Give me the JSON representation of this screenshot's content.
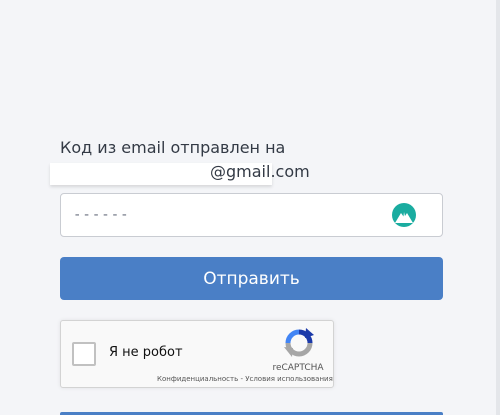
{
  "message": {
    "line1": "Код из email отправлен на",
    "email_suffix": "@gmail.com"
  },
  "code_field": {
    "placeholder": "------",
    "icon": "vpn-mountain-icon",
    "icon_color": "#1aaca0"
  },
  "submit": {
    "label": "Отправить",
    "color": "#4a7fc6"
  },
  "recaptcha": {
    "checkbox_label": "Я не робот",
    "brand": "reCAPTCHA",
    "privacy_link": "Конфиденциальность",
    "separator": "-",
    "terms_link": "Условия использования",
    "logo_icon": "recaptcha-logo-icon"
  }
}
